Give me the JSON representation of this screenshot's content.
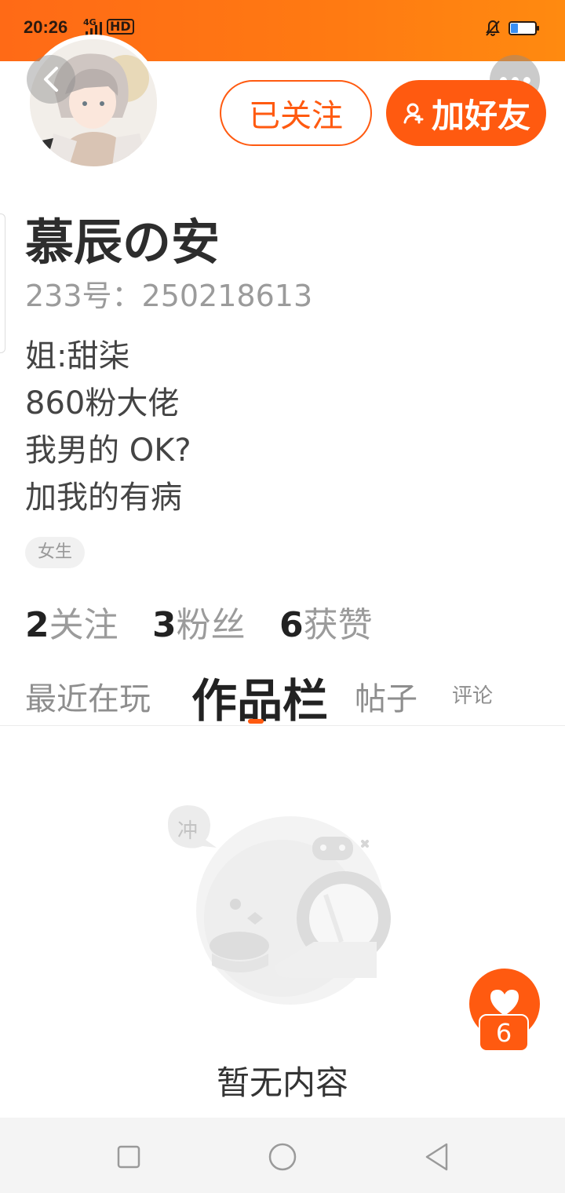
{
  "status_bar": {
    "time": "20:26",
    "network": "4G",
    "hd": "HD",
    "accent": "#ff6a16"
  },
  "header": {
    "back_icon": "chevron-left-icon",
    "more_icon": "more-horizontal-icon",
    "follow_button": "已关注",
    "add_friend_button": "加好友",
    "brand_color": "#ff5a10"
  },
  "profile": {
    "nickname": "慕辰の安",
    "uid": "233号：250218613",
    "bio": [
      "姐:甜柒",
      "860粉大佬",
      "我男的 OK?",
      "加我的有病"
    ],
    "gender_tag": "女生"
  },
  "stats": {
    "following_count": "2",
    "following_label": "关注",
    "followers_count": "3",
    "followers_label": "粉丝",
    "likes_count": "6",
    "likes_label": "获赞"
  },
  "tabs": {
    "recent": "最近在玩",
    "works": "作品栏",
    "posts": "帖子",
    "comments": "评论",
    "active": "作品栏"
  },
  "empty_state": {
    "bubble_text": "冲",
    "message": "暂无内容"
  },
  "like_fab": {
    "icon": "heart-icon",
    "count": "6"
  },
  "nav_bar": {
    "recent_icon": "square-icon",
    "home_icon": "circle-icon",
    "back_icon": "triangle-back-icon"
  }
}
